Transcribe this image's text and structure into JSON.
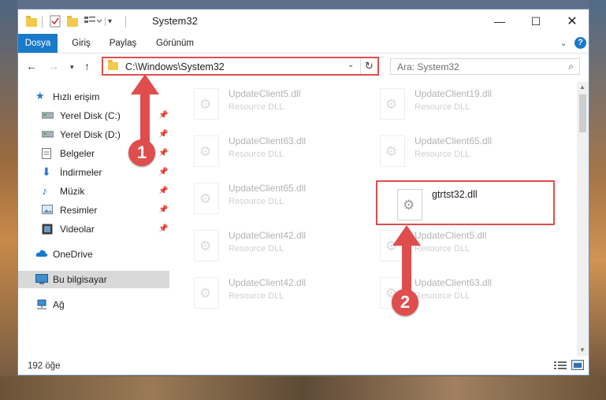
{
  "window": {
    "title": "System32"
  },
  "ribbon": {
    "tabs": [
      "Dosya",
      "Giriş",
      "Paylaş",
      "Görünüm"
    ]
  },
  "address": {
    "path": "C:\\Windows\\System32"
  },
  "search": {
    "placeholder": "Ara: System32"
  },
  "sidebar": {
    "items": [
      {
        "label": "Hızlı erişim",
        "icon": "star-icon"
      },
      {
        "label": "Yerel Disk (C:)",
        "icon": "drive-icon"
      },
      {
        "label": "Yerel Disk (D:)",
        "icon": "drive-icon"
      },
      {
        "label": "Belgeler",
        "icon": "document-icon"
      },
      {
        "label": "İndirmeler",
        "icon": "download-icon"
      },
      {
        "label": "Müzik",
        "icon": "music-icon"
      },
      {
        "label": "Resimler",
        "icon": "pictures-icon"
      },
      {
        "label": "Videolar",
        "icon": "video-icon"
      },
      {
        "label": "OneDrive",
        "icon": "cloud-icon"
      },
      {
        "label": "Bu bilgisayar",
        "icon": "computer-icon"
      },
      {
        "label": "Ağ",
        "icon": "network-icon"
      }
    ]
  },
  "files": [
    {
      "name": "UpdateClient5.dll",
      "type": "Resource DLL"
    },
    {
      "name": "UpdateClient19.dll",
      "type": "Resource DLL"
    },
    {
      "name": "UpdateClient63.dll",
      "type": "Resource DLL"
    },
    {
      "name": "UpdateClient65.dll",
      "type": "Resource DLL"
    },
    {
      "name": "UpdateClient65.dll",
      "type": "Resource DLL"
    },
    {
      "name": "gtrtst32.dll",
      "type": ""
    },
    {
      "name": "UpdateClient42.dll",
      "type": "Resource DLL"
    },
    {
      "name": "UpdateClient5.dll",
      "type": "Resource DLL"
    },
    {
      "name": "UpdateClient42.dll",
      "type": "Resource DLL"
    },
    {
      "name": "UpdateClient63.dll",
      "type": "Resource DLL"
    }
  ],
  "status": {
    "count": "192 öğe"
  },
  "annotations": {
    "step1": "1",
    "step2": "2"
  },
  "colors": {
    "accent": "#1979ca",
    "highlight": "#e04d4d"
  }
}
